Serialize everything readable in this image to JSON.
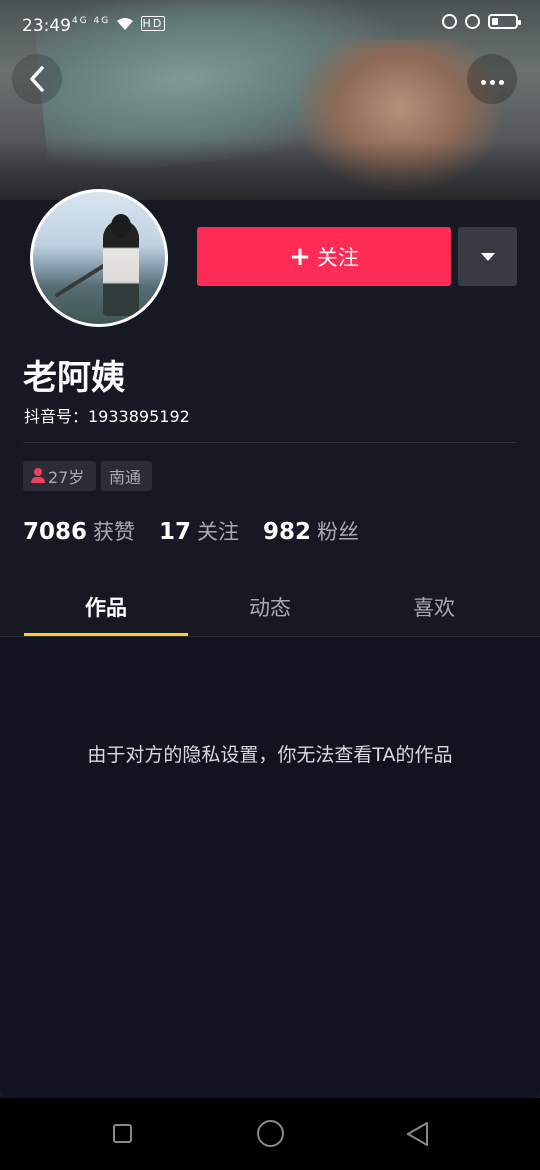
{
  "status_bar": {
    "time": "23:49",
    "left_icons": "4G 4G",
    "network_label": "HD",
    "icons": [
      "signal-icon",
      "wifi-icon",
      "alarm-icon",
      "battery-icon"
    ]
  },
  "header": {
    "back_icon": "chevron-left-icon",
    "more_icon": "more-dots-icon"
  },
  "profile": {
    "nickname": "老阿姨",
    "douyin_id": "抖音号：1933895192",
    "follow_button": {
      "icon": "+",
      "label": "关注",
      "color": "#fe2c55"
    },
    "dropdown_icon": "triangle-down-icon",
    "tags": {
      "age": "27岁",
      "city": "南通"
    },
    "stats": {
      "likes_num": "7086",
      "likes_label": "获赞",
      "following_num": "17",
      "following_label": "关注",
      "followers_num": "982",
      "followers_label": "粉丝"
    }
  },
  "tabs": {
    "items": [
      "作品",
      "动态",
      "喜欢"
    ],
    "active": "作品",
    "indicator_color": "#facd35"
  },
  "content": {
    "message": "由于对方的隐私设置，你无法查看TA的作品"
  },
  "nav_bar": {
    "icons": [
      "recent-apps-icon",
      "home-icon",
      "back-icon"
    ]
  }
}
